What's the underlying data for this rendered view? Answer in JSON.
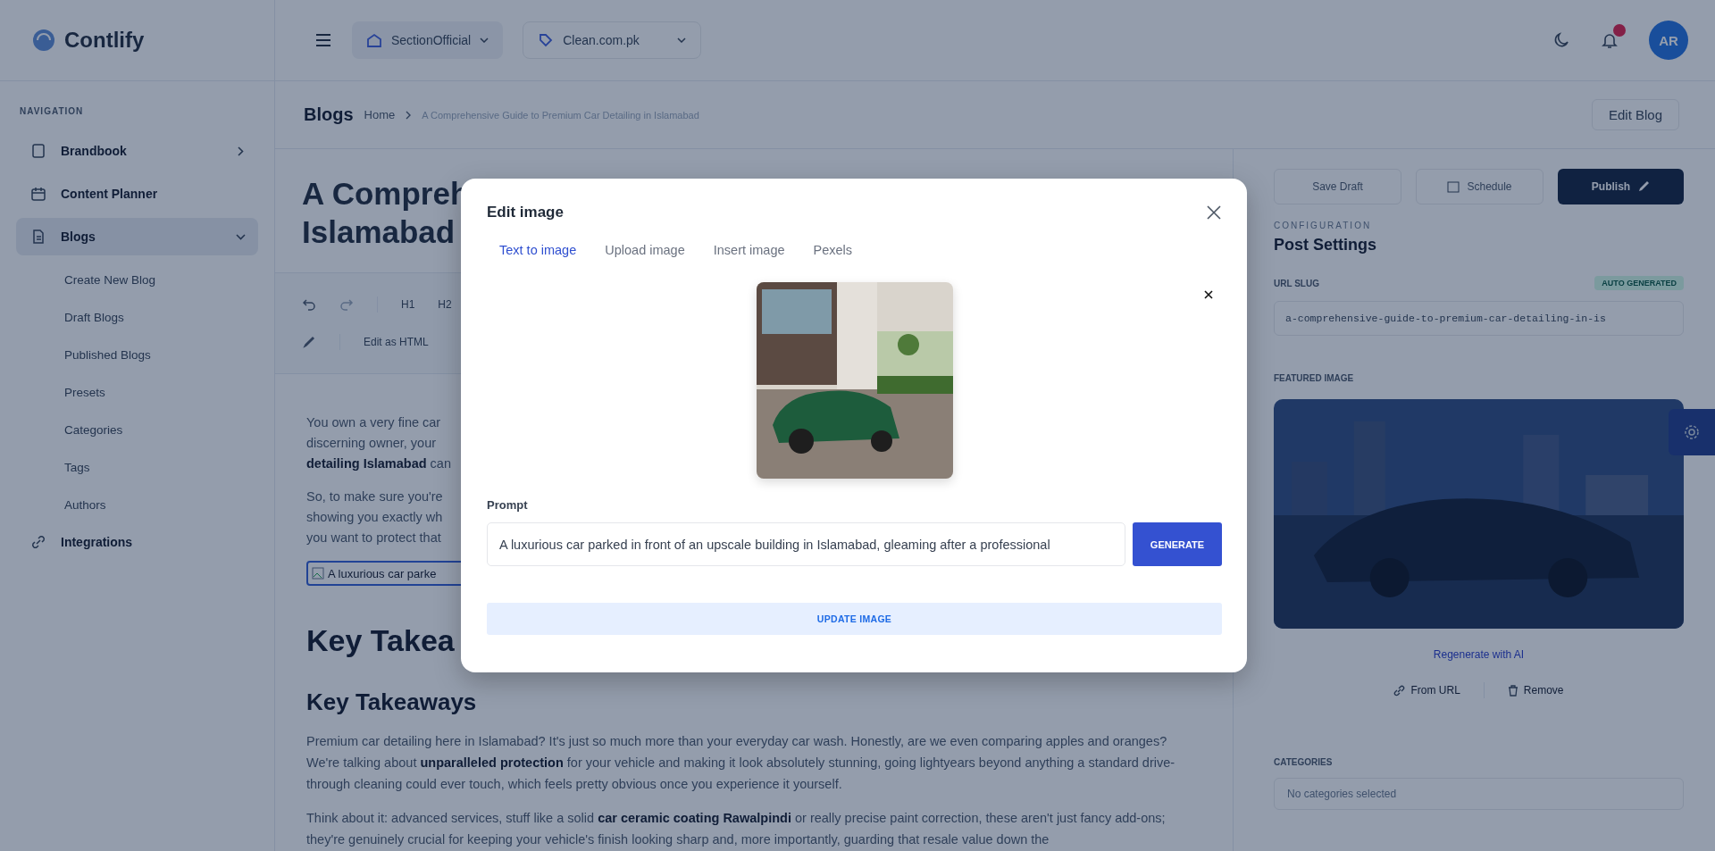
{
  "app": {
    "logo": "Contlify"
  },
  "topbar": {
    "workspace": "SectionOfficial",
    "site": "Clean.com.pk",
    "avatar": "AR",
    "notifications": true
  },
  "breadcrumb": {
    "title": "Blogs",
    "items": [
      "Home",
      "A Comprehensive Guide to Premium Car Detailing in Islamabad"
    ],
    "action": "Edit Blog"
  },
  "sidebar": {
    "section": "NAVIGATION",
    "items": [
      {
        "label": "Brandbook",
        "expanded": false,
        "selected": false
      },
      {
        "label": "Content Planner",
        "selected": false
      },
      {
        "label": "Blogs",
        "expanded": true,
        "selected": true,
        "children": [
          {
            "label": "Create New Blog"
          },
          {
            "label": "Draft Blogs"
          },
          {
            "label": "Published Blogs"
          },
          {
            "label": "Presets"
          },
          {
            "label": "Categories"
          },
          {
            "label": "Tags"
          },
          {
            "label": "Authors"
          }
        ]
      },
      {
        "label": "Integrations",
        "selected": false
      }
    ]
  },
  "editor": {
    "title_lines": [
      "A Compreh",
      "Islamabad"
    ],
    "toolbar": [
      {
        "kind": "undo"
      },
      {
        "kind": "redo"
      },
      {
        "kind": "text",
        "label": "H1"
      },
      {
        "kind": "text",
        "label": "H2"
      }
    ],
    "toolbar_row2": [
      {
        "kind": "pen"
      },
      {
        "kind": "text",
        "label": "Edit as HTML"
      }
    ],
    "intro_paragraphs": [
      [
        "You own a very fine car",
        "discerning owner, your",
        "**detailing Islamabad** can"
      ],
      [
        "So, to make sure you're",
        "showing you exactly wh",
        "you want to protect that"
      ]
    ],
    "image_alt": "A luxurious car parke",
    "heading1": "Key Takea",
    "heading2": "Key Takeaways",
    "paragraphs": [
      "Premium car detailing here in Islamabad? It's just so much more than your everyday car wash. Honestly, are we even comparing apples and oranges? We're talking about **unparalleled protection** for your vehicle and making it look absolutely stunning, going lightyears beyond anything a standard drive-through cleaning could ever touch, which feels pretty obvious once you experience it yourself.",
      "Think about it: advanced services, stuff like a solid **car ceramic coating Rawalpindi** or really precise paint correction, these aren't just fancy add-ons; they're genuinely crucial for keeping your vehicle's finish looking sharp and, more importantly, guarding that resale value down the"
    ]
  },
  "settings": {
    "actions": [
      {
        "label": "Save Draft",
        "kind": "plain"
      },
      {
        "label": "Schedule",
        "kind": "icon"
      },
      {
        "label": "Publish",
        "kind": "primary"
      }
    ],
    "section_label": "CONFIGURATION",
    "heading": "Post Settings",
    "slug_label": "URL SLUG",
    "slug_badge": "AUTO GENERATED",
    "slug": "a-comprehensive-guide-to-premium-car-detailing-in-is",
    "featured_label": "FEATURED IMAGE",
    "regenerate": "Regenerate with AI",
    "image_actions": [
      {
        "label": "From URL",
        "kind": "link"
      },
      {
        "label": "Remove",
        "kind": "trash"
      }
    ],
    "categories_label": "CATEGORIES",
    "categories_placeholder": "No categories selected"
  },
  "modal": {
    "title": "Edit image",
    "tabs": [
      {
        "label": "Text to image",
        "selected": true
      },
      {
        "label": "Upload image",
        "selected": false
      },
      {
        "label": "Insert image",
        "selected": false
      },
      {
        "label": "Pexels",
        "selected": false
      }
    ],
    "prompt_label": "Prompt",
    "prompt": "A luxurious car parked in front of an upscale building in Islamabad, gleaming after a professional",
    "generate": "GENERATE",
    "update": "UPDATE IMAGE"
  }
}
